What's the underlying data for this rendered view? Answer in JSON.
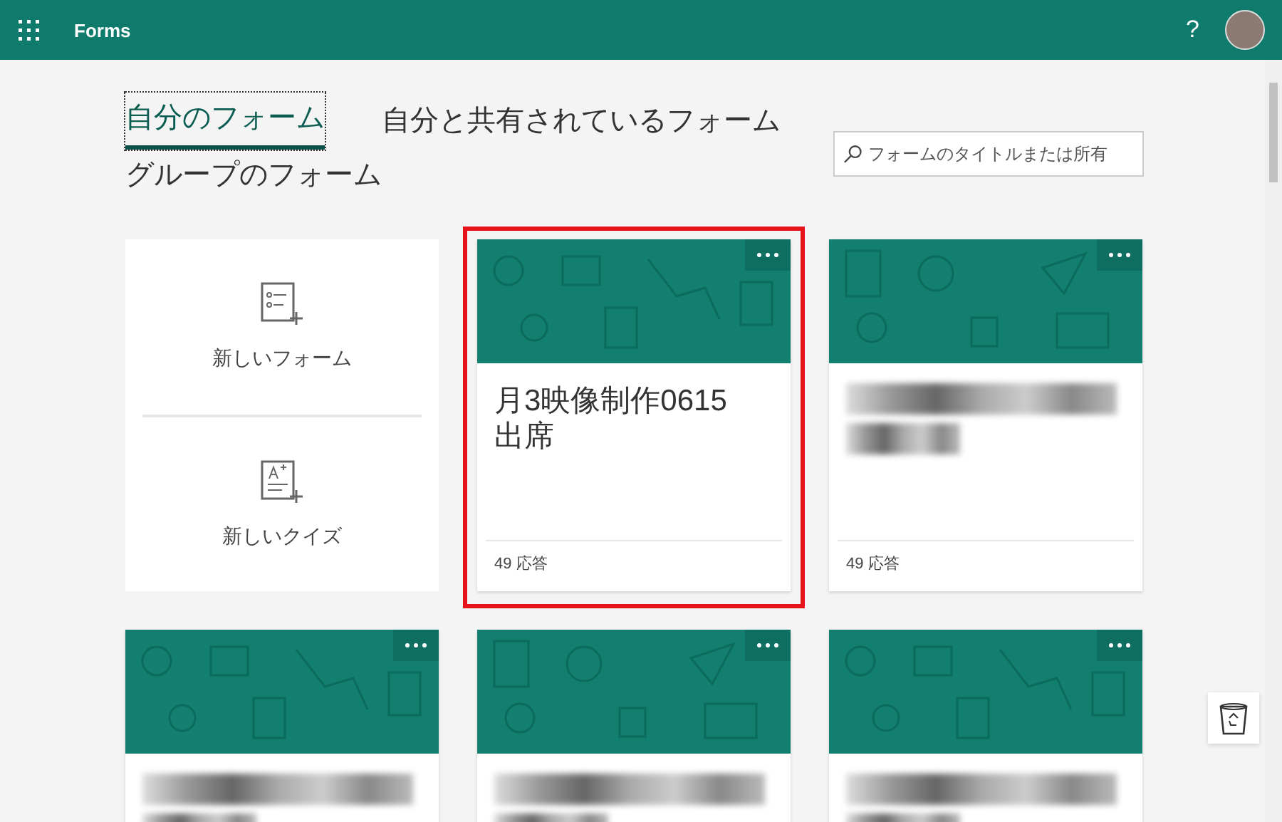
{
  "app_bar": {
    "title": "Forms",
    "help": "?"
  },
  "tabs": [
    {
      "label": "自分のフォーム",
      "selected": true
    },
    {
      "label": "自分と共有されているフォーム",
      "selected": false
    },
    {
      "label": "グループのフォーム",
      "selected": false
    }
  ],
  "search": {
    "placeholder": "フォームのタイトルまたは所有"
  },
  "new_items": [
    {
      "kind": "form",
      "label": "新しいフォーム"
    },
    {
      "kind": "quiz",
      "label": "新しいクイズ"
    }
  ],
  "forms": [
    {
      "kind": "titled",
      "title": "月3映像制作0615 出席",
      "responses": "49 応答",
      "highlighted": true
    },
    {
      "kind": "redacted",
      "responses": "49 応答",
      "highlighted": false
    },
    {
      "kind": "redacted",
      "highlighted": false
    },
    {
      "kind": "redacted",
      "highlighted": false
    },
    {
      "kind": "redacted",
      "highlighted": false
    }
  ]
}
